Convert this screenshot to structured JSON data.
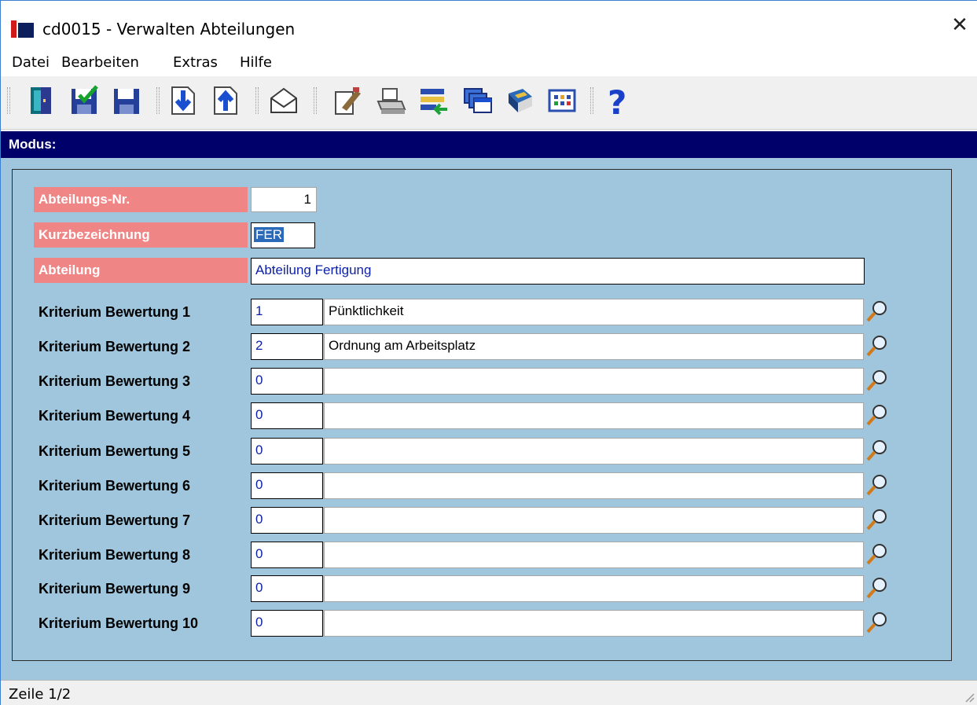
{
  "window": {
    "title": "cd0015 - Verwalten Abteilungen",
    "close_symbol": "✕"
  },
  "menu": [
    "Datei",
    "Bearbeiten",
    "Extras",
    "Hilfe"
  ],
  "toolbar": {
    "icons": [
      "exit-door-icon",
      "save-check-icon",
      "save-icon",
      "page-down-icon",
      "page-up-icon",
      "envelope-icon",
      "edit-note-icon",
      "printer-icon",
      "list-transfer-icon",
      "windows-icon",
      "book-icon",
      "grid-icon",
      "help-icon"
    ]
  },
  "mode": {
    "label": "Modus:"
  },
  "form": {
    "abteilungs_nr": {
      "label": "Abteilungs-Nr.",
      "value": "1"
    },
    "kurzbezeichnung": {
      "label": "Kurzbezeichnung",
      "value": "FER"
    },
    "abteilung": {
      "label": "Abteilung",
      "value": "Abteilung Fertigung"
    },
    "kriterien": [
      {
        "label": "Kriterium Bewertung 1",
        "code": "1",
        "name": "Pünktlichkeit"
      },
      {
        "label": "Kriterium Bewertung 2",
        "code": "2",
        "name": "Ordnung am Arbeitsplatz"
      },
      {
        "label": "Kriterium Bewertung 3",
        "code": "0",
        "name": ""
      },
      {
        "label": "Kriterium Bewertung 4",
        "code": "0",
        "name": ""
      },
      {
        "label": "Kriterium Bewertung 5",
        "code": "0",
        "name": ""
      },
      {
        "label": "Kriterium Bewertung 6",
        "code": "0",
        "name": ""
      },
      {
        "label": "Kriterium Bewertung 7",
        "code": "0",
        "name": ""
      },
      {
        "label": "Kriterium Bewertung 8",
        "code": "0",
        "name": ""
      },
      {
        "label": "Kriterium Bewertung 9",
        "code": "0",
        "name": ""
      },
      {
        "label": "Kriterium Bewertung 10",
        "code": "0",
        "name": ""
      }
    ]
  },
  "status": {
    "text": "Zeile 1/2"
  },
  "colors": {
    "mode_bar": "#00006b",
    "panel_bg": "#9fc6dd",
    "required_label_bg": "#f08585",
    "value_blue": "#0b1fa8"
  }
}
